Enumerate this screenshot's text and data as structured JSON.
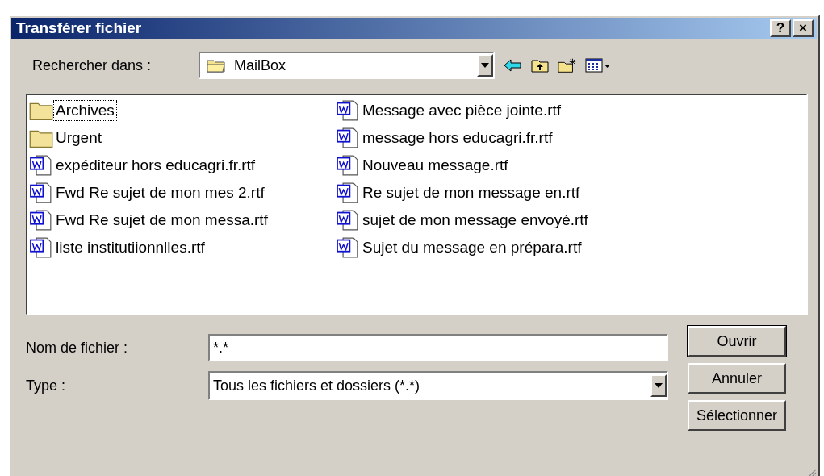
{
  "window": {
    "title": "Transférer fichier",
    "title_buttons": [
      "?",
      "×"
    ]
  },
  "look_in": {
    "label": "Rechercher dans :",
    "value": "MailBox"
  },
  "files": [
    {
      "name": "Archives",
      "kind": "folder",
      "focused": true
    },
    {
      "name": "Urgent",
      "kind": "folder",
      "focused": false
    },
    {
      "name": "expéditeur hors educagri.fr.rtf",
      "kind": "document",
      "focused": false
    },
    {
      "name": "Fwd Re sujet de mon mes 2.rtf",
      "kind": "document",
      "focused": false
    },
    {
      "name": "Fwd Re sujet de mon messa.rtf",
      "kind": "document",
      "focused": false
    },
    {
      "name": "liste institutiionnlles.rtf",
      "kind": "document",
      "focused": false
    },
    {
      "name": "Message avec pièce jointe.rtf",
      "kind": "document",
      "focused": false
    },
    {
      "name": "message hors educagri.fr.rtf",
      "kind": "document",
      "focused": false
    },
    {
      "name": "Nouveau message.rtf",
      "kind": "document",
      "focused": false
    },
    {
      "name": "Re sujet de mon message en.rtf",
      "kind": "document",
      "focused": false
    },
    {
      "name": "sujet de mon message envoyé.rtf",
      "kind": "document",
      "focused": false
    },
    {
      "name": "Sujet du message en prépara.rtf",
      "kind": "document",
      "focused": false
    }
  ],
  "file_name": {
    "label": "Nom de fichier :",
    "value": "*.*"
  },
  "file_type": {
    "label": "Type :",
    "value": "Tous les fichiers et dossiers (*.*)"
  },
  "buttons": [
    {
      "label": "Ouvrir",
      "default": true
    },
    {
      "label": "Annuler",
      "default": false
    },
    {
      "label": "Sélectionner",
      "default": false
    }
  ]
}
